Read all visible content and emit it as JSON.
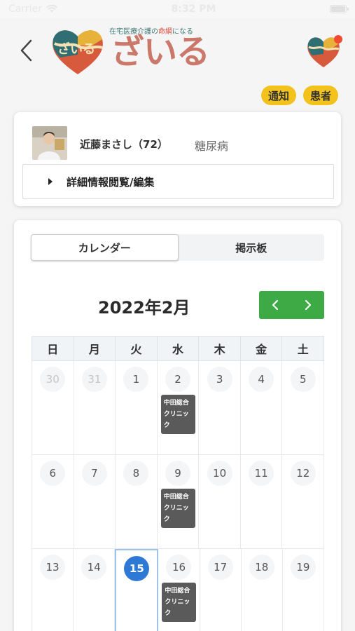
{
  "status_bar": {
    "carrier": "Carrier",
    "time": "8:32 PM"
  },
  "header": {
    "logo_tagline_pre": "在宅医療介護の",
    "logo_tagline_accent": "命綱",
    "logo_tagline_post": "になる",
    "logo_word": "ざいる",
    "logo_heart_text": "ざいる"
  },
  "pills": {
    "notify": "通知",
    "patient": "患者"
  },
  "patient": {
    "name": "近藤まさし（72）",
    "disease": "糖尿病",
    "detail_label": "詳細情報閲覧/編集"
  },
  "calendar": {
    "tabs": [
      {
        "label": "カレンダー",
        "active": true
      },
      {
        "label": "掲示板",
        "active": false
      }
    ],
    "month": "2022年2月",
    "weekdays": [
      "日",
      "月",
      "火",
      "水",
      "木",
      "金",
      "土"
    ],
    "weeks": [
      [
        {
          "d": "30",
          "muted": true
        },
        {
          "d": "31",
          "muted": true
        },
        {
          "d": "1"
        },
        {
          "d": "2",
          "event": "中田総合クリニック"
        },
        {
          "d": "3"
        },
        {
          "d": "4"
        },
        {
          "d": "5"
        }
      ],
      [
        {
          "d": "6"
        },
        {
          "d": "7"
        },
        {
          "d": "8"
        },
        {
          "d": "9",
          "event": "中田総合クリニック"
        },
        {
          "d": "10"
        },
        {
          "d": "11"
        },
        {
          "d": "12"
        }
      ],
      [
        {
          "d": "13"
        },
        {
          "d": "14"
        },
        {
          "d": "15",
          "today": true
        },
        {
          "d": "16",
          "event": "中田総合クリニック"
        },
        {
          "d": "17"
        },
        {
          "d": "18"
        },
        {
          "d": "19"
        }
      ]
    ]
  },
  "colors": {
    "accent_yellow": "#f4c21d",
    "nav_green": "#3eaa46",
    "today_blue": "#2f79d6",
    "event_gray": "#5a5a5a"
  }
}
